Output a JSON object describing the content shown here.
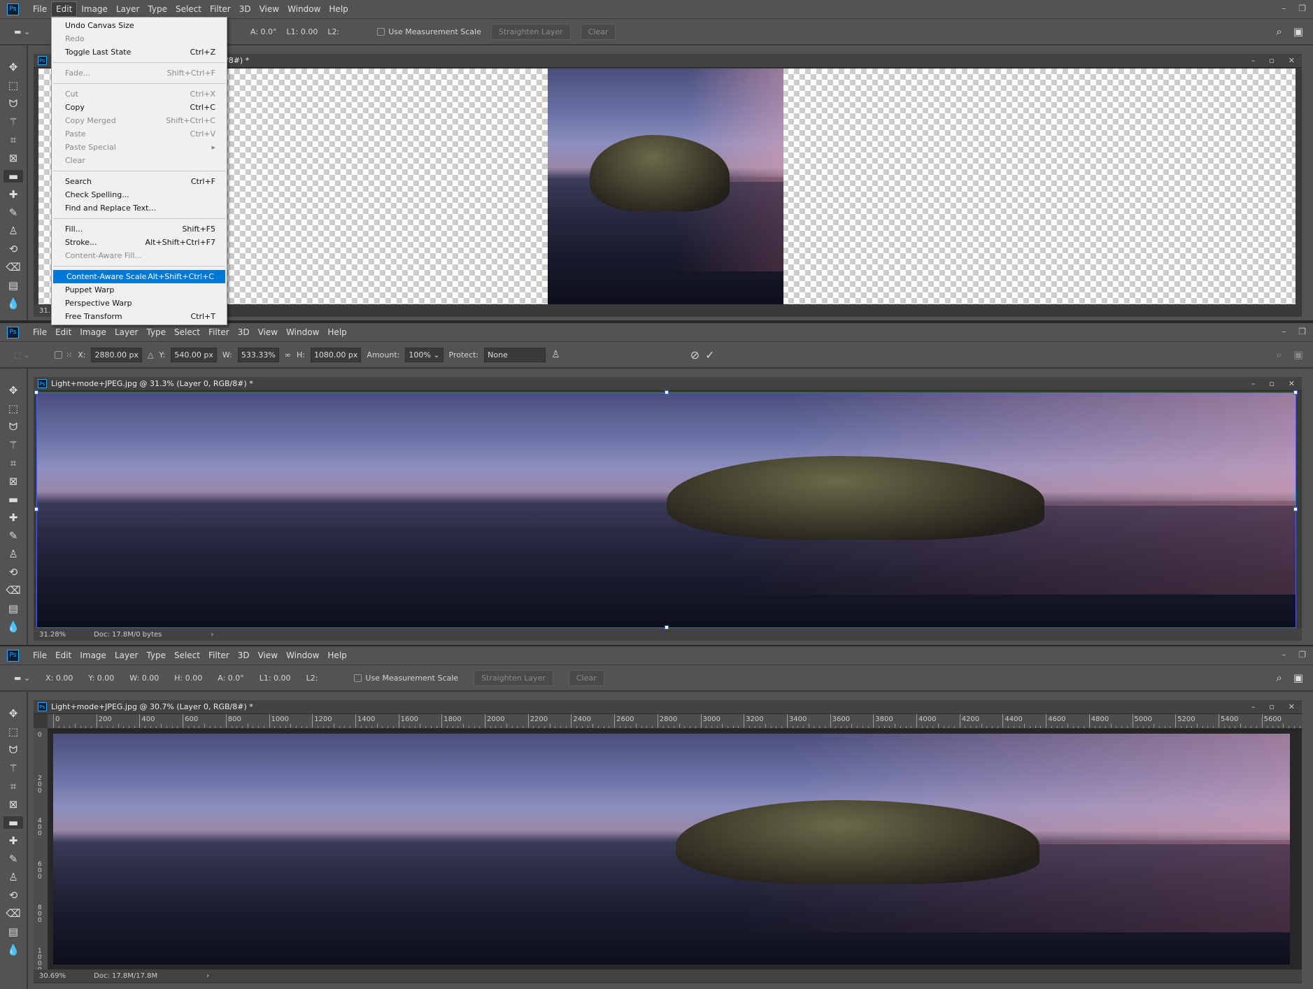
{
  "menu": [
    "File",
    "Edit",
    "Image",
    "Layer",
    "Type",
    "Select",
    "Filter",
    "3D",
    "View",
    "Window",
    "Help"
  ],
  "panel1": {
    "options": {
      "angle": "A: 0.0°",
      "l1": "L1: 0.00",
      "l2": "L2:",
      "use_scale": "Use Measurement Scale",
      "straighten": "Straighten Layer",
      "clear": "Clear"
    },
    "doc_title": "/8#) *",
    "zoom": "31.",
    "edit_menu": [
      {
        "label": "Undo Canvas Size",
        "shortcut": "",
        "enabled": true
      },
      {
        "label": "Redo",
        "shortcut": "",
        "enabled": false
      },
      {
        "label": "Toggle Last State",
        "shortcut": "Ctrl+Z",
        "enabled": true
      },
      {
        "sep": true
      },
      {
        "label": "Fade...",
        "shortcut": "Shift+Ctrl+F",
        "enabled": false
      },
      {
        "sep": true
      },
      {
        "label": "Cut",
        "shortcut": "Ctrl+X",
        "enabled": false
      },
      {
        "label": "Copy",
        "shortcut": "Ctrl+C",
        "enabled": true
      },
      {
        "label": "Copy Merged",
        "shortcut": "Shift+Ctrl+C",
        "enabled": false
      },
      {
        "label": "Paste",
        "shortcut": "Ctrl+V",
        "enabled": false
      },
      {
        "label": "Paste Special",
        "shortcut": "▸",
        "enabled": false
      },
      {
        "label": "Clear",
        "shortcut": "",
        "enabled": false
      },
      {
        "sep": true
      },
      {
        "label": "Search",
        "shortcut": "Ctrl+F",
        "enabled": true
      },
      {
        "label": "Check Spelling...",
        "shortcut": "",
        "enabled": true
      },
      {
        "label": "Find and Replace Text...",
        "shortcut": "",
        "enabled": true
      },
      {
        "sep": true
      },
      {
        "label": "Fill...",
        "shortcut": "Shift+F5",
        "enabled": true
      },
      {
        "label": "Stroke...",
        "shortcut": "Alt+Shift+Ctrl+F7",
        "enabled": true
      },
      {
        "label": "Content-Aware Fill...",
        "shortcut": "",
        "enabled": false
      },
      {
        "sep": true
      },
      {
        "label": "Content-Aware Scale",
        "shortcut": "Alt+Shift+Ctrl+C",
        "enabled": true,
        "highlighted": true
      },
      {
        "label": "Puppet Warp",
        "shortcut": "",
        "enabled": true
      },
      {
        "label": "Perspective Warp",
        "shortcut": "",
        "enabled": true
      },
      {
        "label": "Free Transform",
        "shortcut": "Ctrl+T",
        "enabled": true
      }
    ]
  },
  "panel2": {
    "options": {
      "x_label": "X:",
      "x": "2880.00 px",
      "y_label": "Y:",
      "y": "540.00 px",
      "w_label": "W:",
      "w": "533.33%",
      "h_label": "H:",
      "h": "1080.00 px",
      "amount_label": "Amount:",
      "amount": "100%",
      "protect_label": "Protect:",
      "protect": "None"
    },
    "doc_title": "Light+mode+JPEG.jpg @ 31.3% (Layer 0, RGB/8#) *",
    "zoom": "31.28%",
    "doc": "Doc: 17.8M/0 bytes"
  },
  "panel3": {
    "options": {
      "x": "X: 0.00",
      "y": "Y: 0.00",
      "w": "W:  0.00",
      "h": "H: 0.00",
      "angle": "A: 0.0°",
      "l1": "L1: 0.00",
      "l2": "L2:",
      "use_scale": "Use Measurement Scale",
      "straighten": "Straighten Layer",
      "clear": "Clear"
    },
    "doc_title": "Light+mode+JPEG.jpg @ 30.7% (Layer 0, RGB/8#) *",
    "ruler_h": [
      "0",
      "200",
      "400",
      "600",
      "800",
      "1000",
      "1200",
      "1400",
      "1600",
      "1800",
      "2000",
      "2200",
      "2400",
      "2600",
      "2800",
      "3000",
      "3200",
      "3400",
      "3600",
      "3800",
      "4000",
      "4200",
      "4400",
      "4600",
      "4800",
      "5000",
      "5200",
      "5400",
      "5600"
    ],
    "ruler_v": [
      "0",
      "200",
      "400",
      "600",
      "800",
      "1000"
    ],
    "zoom": "30.69%",
    "doc": "Doc: 17.8M/17.8M"
  },
  "colors": {
    "accent": "#0078d7",
    "ps_blue": "#31a8ff",
    "ui_bg": "#535353"
  }
}
